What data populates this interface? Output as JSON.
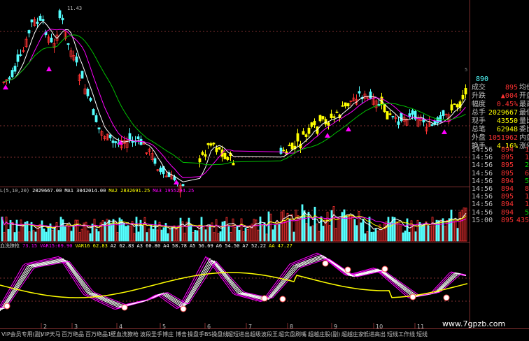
{
  "colors": {
    "bg": "#000000",
    "up": "#ff3232",
    "down": "#54ffff",
    "yellow": "#ffff00",
    "white": "#ffffff",
    "magenta": "#ff00ff",
    "green": "#00e000"
  },
  "top": {
    "price_label": "11.43",
    "side_number": "890",
    "side_marker": "5"
  },
  "right_panel": {
    "quote": [
      {
        "label": "成交",
        "value": "895",
        "tail": "均价",
        "color": "red"
      },
      {
        "label": "升跌",
        "value": "▲004",
        "tail": "开盘",
        "color": "red"
      },
      {
        "label": "幅度",
        "value": "0.45%",
        "tail": "最高",
        "color": "red"
      },
      {
        "label": "总手",
        "value": "2029667",
        "tail": "最低",
        "color": "yel"
      },
      {
        "label": "现手",
        "value": "43550",
        "tail": "量比",
        "color": "yel"
      },
      {
        "label": "总笔",
        "value": "62948",
        "tail": "委比",
        "color": "yel"
      },
      {
        "label": "外盘",
        "value": "1051962",
        "tail": "内盘",
        "color": "red"
      },
      {
        "label": "换手",
        "value": "4.16%",
        "tail": "涨停",
        "color": "yel"
      }
    ],
    "ticks": [
      {
        "time": "14:56",
        "price": "894",
        "vol": "1",
        "pcolor": "red",
        "vcolor": "red"
      },
      {
        "time": "14:56",
        "price": "895",
        "vol": "1",
        "pcolor": "red",
        "vcolor": "red"
      },
      {
        "time": "14:56",
        "price": "895",
        "vol": "2",
        "pcolor": "red",
        "vcolor": "grn"
      },
      {
        "time": "14:56",
        "price": "895",
        "vol": "6",
        "pcolor": "red",
        "vcolor": "red"
      },
      {
        "time": "14:56",
        "price": "894",
        "vol": "5",
        "pcolor": "red",
        "vcolor": "grn"
      },
      {
        "time": "14:56",
        "price": "894",
        "vol": "8",
        "pcolor": "red",
        "vcolor": "red"
      },
      {
        "time": "14:56",
        "price": "895",
        "vol": "1",
        "pcolor": "red",
        "vcolor": "red"
      },
      {
        "time": "14:56",
        "price": "894",
        "vol": "1",
        "pcolor": "red",
        "vcolor": "red"
      },
      {
        "time": "14:56",
        "price": "894",
        "vol": "5",
        "pcolor": "red",
        "vcolor": "grn"
      },
      {
        "time": "15:00",
        "price": "895",
        "vol": "435",
        "pcolor": "red",
        "vcolor": "red"
      }
    ]
  },
  "volume_indicator": [
    {
      "text": "L(5,10,20)",
      "color": "#c0c0c0"
    },
    {
      "text": "2029667.00",
      "color": "#ffffff"
    },
    {
      "text": "MA1 3042014.00",
      "color": "#ffffff"
    },
    {
      "text": "MA2 2832691.25",
      "color": "#ffff00"
    },
    {
      "text": "MA3 1955294.25",
      "color": "#ff00ff"
    }
  ],
  "oscillator_indicator": [
    {
      "text": "血洗獠枪",
      "color": "#c0c0c0"
    },
    {
      "text": "73.15",
      "color": "#ff00ff"
    },
    {
      "text": "VAR15:69.90",
      "color": "#ff00ff"
    },
    {
      "text": "VAR16 62.83",
      "color": "#ffff00"
    },
    {
      "text": "A2 62.83",
      "color": "#ffffff"
    },
    {
      "text": "A3 60.80",
      "color": "#ffffff"
    },
    {
      "text": "A4 58.78",
      "color": "#ffffff"
    },
    {
      "text": "A5 56.69",
      "color": "#ffffff"
    },
    {
      "text": "A6 54.50",
      "color": "#ffffff"
    },
    {
      "text": "A7 52.22",
      "color": "#ffffff"
    },
    {
      "text": "AA 47.27",
      "color": "#ffff00"
    }
  ],
  "axis_labels": [
    "2",
    "3",
    "4",
    "5",
    "6",
    "7",
    "8",
    "9",
    "10",
    "11"
  ],
  "tabs": [
    "VIP会员专用(副)",
    "VIP天马",
    "百万绝品",
    "百万绝品1",
    "壁血洗獠枪",
    "波段圣手",
    "博庄",
    "博击",
    "操盘手BS操盘线",
    "超短进出",
    "超级波段王",
    "超实盘刷嘴",
    "超越庄股(副)",
    "超越庄家",
    "低进高出",
    "短线工作线",
    "短线"
  ],
  "watermark": "www.7gpzb.com"
}
